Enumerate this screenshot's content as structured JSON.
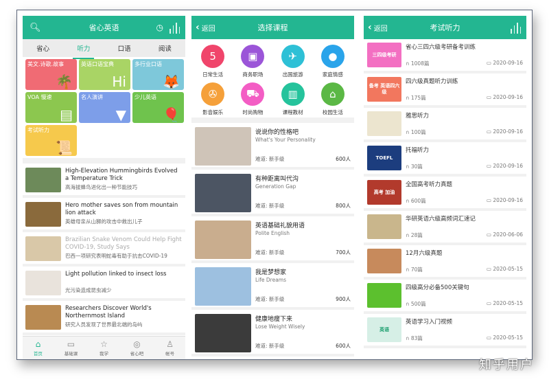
{
  "screen1": {
    "header": {
      "title": "省心英语",
      "icons": [
        "search-icon",
        "history-icon",
        "audio-bars-icon"
      ]
    },
    "tabs": [
      {
        "label": "省心",
        "active": false
      },
      {
        "label": "听力",
        "active": true
      },
      {
        "label": "口语",
        "active": false
      },
      {
        "label": "阅读",
        "active": false
      }
    ],
    "tiles": [
      {
        "label": "美文.诗歌.故事",
        "color": "#f06b74",
        "icon": "palm-tree-icon"
      },
      {
        "label": "英语口语宝典",
        "color": "#a9d465",
        "icon": "hi-bubble-icon"
      },
      {
        "label": "多行业口语",
        "color": "#7ec8da",
        "icon": "fox-icon"
      },
      {
        "label": "VOA 慢速",
        "color": "#8cc74f",
        "icon": "newspaper-icon"
      },
      {
        "label": "名人演讲",
        "color": "#7d9ee9",
        "icon": "podium-icon"
      },
      {
        "label": "少儿英语",
        "color": "#6fc34d",
        "icon": "balloons-icon"
      },
      {
        "label": "考试听力",
        "color": "#f6c94c",
        "icon": "diploma-icon"
      }
    ],
    "news": [
      {
        "en": "High-Elevation Hummingbirds Evolved a Temperature Trick",
        "cn": "高海拔蜂鸟进化出一种节能技巧",
        "read": false,
        "thumb": "#6d8a5a"
      },
      {
        "en": "Hero mother saves son from mountain lion attack",
        "cn": "英雄母亲从山狮的攻击中救出儿子",
        "read": false,
        "thumb": "#8a6a3c"
      },
      {
        "en": "Brazilian Snake Venom Could Help Fight COVID-19, Study Says",
        "cn": "巴西一项研究表明蛇毒有助于抗击COVID-19",
        "read": true,
        "thumb": "#d9c8a8"
      },
      {
        "en": "Light pollution linked to insect loss",
        "cn": "光污染造成昆虫减少",
        "read": false,
        "thumb": "#e9e3dc"
      },
      {
        "en": "Researchers Discover World's Northernmost Island",
        "cn": "研究人员发现了世界最北端的岛屿",
        "read": false,
        "thumb": "#b98a52"
      }
    ],
    "tabbar": [
      {
        "label": "首页",
        "icon": "home-icon",
        "glyph": "⌂",
        "active": true
      },
      {
        "label": "基础课",
        "icon": "wallet-icon",
        "glyph": "▭",
        "active": false
      },
      {
        "label": "我学",
        "icon": "star-icon",
        "glyph": "☆",
        "active": false
      },
      {
        "label": "省心吧",
        "icon": "aperture-icon",
        "glyph": "◎",
        "active": false
      },
      {
        "label": "帐号",
        "icon": "user-icon",
        "glyph": "♙",
        "active": false
      }
    ]
  },
  "screen2": {
    "header": {
      "back_label": "返回",
      "title": "选择课程"
    },
    "categories": [
      {
        "label": "日常生活",
        "color": "#f0456b",
        "icon": "calendar-icon",
        "glyph": "5"
      },
      {
        "label": "商务职场",
        "color": "#9b55d8",
        "icon": "briefcase-icon",
        "glyph": "▣"
      },
      {
        "label": "出国旅游",
        "color": "#2ec0d6",
        "icon": "airplane-icon",
        "glyph": "✈"
      },
      {
        "label": "家庭情感",
        "color": "#2aa4ea",
        "icon": "location-pin-icon",
        "glyph": "●"
      },
      {
        "label": "影音娱乐",
        "color": "#f5a03a",
        "icon": "film-reel-icon",
        "glyph": "✇"
      },
      {
        "label": "时尚购物",
        "color": "#f35dc4",
        "icon": "shopping-cart-icon",
        "glyph": "⛟"
      },
      {
        "label": "课程教材",
        "color": "#25c39c",
        "icon": "book-icon",
        "glyph": "▥"
      },
      {
        "label": "校园生活",
        "color": "#5bb845",
        "icon": "school-icon",
        "glyph": "⌂"
      }
    ],
    "difficulty_prefix": "难道: ",
    "courses": [
      {
        "cn": "说说你的性格吧",
        "en": "What's Your Personality",
        "difficulty": "难道: 新手级",
        "count": "600人",
        "thumb": "#cfc4b8"
      },
      {
        "cn": "有种距离叫代沟",
        "en": "Generation Gap",
        "difficulty": "难道: 新手级",
        "count": "800人",
        "thumb": "#4c5563"
      },
      {
        "cn": "英语基础礼貌用语",
        "en": "Polite English",
        "difficulty": "难道: 新手级",
        "count": "700人",
        "thumb": "#c9ad8e"
      },
      {
        "cn": "我是梦想家",
        "en": "Life Dreams",
        "difficulty": "难道: 新手级",
        "count": "900人",
        "thumb": "#9dc0e0"
      },
      {
        "cn": "健康地瘦下来",
        "en": "Lose Weight Wisely",
        "difficulty": "难道: 新手级",
        "count": "600人",
        "thumb": "#3b3b3b"
      }
    ]
  },
  "screen3": {
    "header": {
      "back_label": "返回",
      "title": "考试听力"
    },
    "items": [
      {
        "title": "省心三四六级考研备考训练",
        "count": "1008篇",
        "date": "2020-09-16",
        "thumb_color": "#f36fc2",
        "thumb_text": "三四级考研"
      },
      {
        "title": "四六级真题听力训练",
        "count": "175篇",
        "date": "2020-09-16",
        "thumb_color": "#f2775e",
        "thumb_text": "备考 英语四六级"
      },
      {
        "title": "雅思听力",
        "count": "100篇",
        "date": "2020-09-16",
        "thumb_color": "#ece5cf",
        "thumb_text": ""
      },
      {
        "title": "托福听力",
        "count": "30篇",
        "date": "2020-09-16",
        "thumb_color": "#1c3d7e",
        "thumb_text": "TOEFL"
      },
      {
        "title": "全国高考听力真题",
        "count": "600篇",
        "date": "2020-09-16",
        "thumb_color": "#b23a2c",
        "thumb_text": "高考 加油"
      },
      {
        "title": "华研英语六级高频词汇速记",
        "count": "28篇",
        "date": "2020-06-06",
        "thumb_color": "#c9b68c",
        "thumb_text": ""
      },
      {
        "title": "12月六级真题",
        "count": "70篇",
        "date": "2020-05-15",
        "thumb_color": "#c78a5c",
        "thumb_text": ""
      },
      {
        "title": "四级高分必备500关键句",
        "count": "500篇",
        "date": "2020-05-15",
        "thumb_color": "#5cc02e",
        "thumb_text": ""
      },
      {
        "title": "英语学习入门视频",
        "count": "83篇",
        "date": "2020-05-15",
        "thumb_color": "#d6efe6",
        "thumb_text": "英语"
      }
    ]
  },
  "watermark": "知乎用户"
}
